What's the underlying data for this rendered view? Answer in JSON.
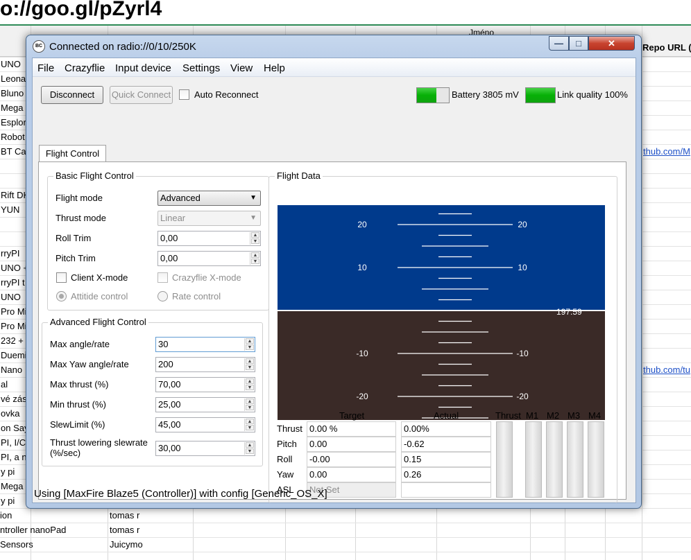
{
  "background": {
    "url_text": "o://goo.gl/pZyrl4",
    "header_name": "Jméno",
    "header_repo": "Repo URL (v",
    "left_rows": [
      "UNO",
      "Leonar",
      "Bluno",
      "Mega",
      "Esplor",
      "Robot",
      "BT Ca",
      "",
      "",
      "Rift DK",
      "YUN",
      "",
      "",
      "rryPI",
      "UNO +",
      "rryPI t",
      "UNO",
      "Pro Mi",
      "Pro Mi",
      "232 +",
      "Duemil",
      "Nano",
      "al",
      "vé zás",
      "ovka",
      "on Say",
      "PI, I/C",
      "PI, a n",
      "y pi",
      "Mega",
      "y pi"
    ],
    "bottom_rows": [
      {
        "left": "ion",
        "right": "tomas r"
      },
      {
        "left": "ntroller nanoPad",
        "right": "tomas r"
      },
      {
        "left": "Sensors",
        "right": "Juicymo"
      }
    ],
    "links": [
      "thub.com/M",
      "thub.com/tu"
    ]
  },
  "window": {
    "title": "Connected on radio://0/10/250K",
    "icon_text": "BC",
    "caption_min": "—",
    "caption_max": "□",
    "caption_close": "✕"
  },
  "menu": [
    "File",
    "Crazyflie",
    "Input device",
    "Settings",
    "View",
    "Help"
  ],
  "toolbar": {
    "disconnect": "Disconnect",
    "quick_connect": "Quick Connect",
    "auto_reconnect": "Auto Reconnect",
    "battery_label": "Battery 3805 mV",
    "battery_level": 0.6,
    "link_label": "Link quality 100%",
    "link_level": 1.0
  },
  "tab": "Flight Control",
  "basic": {
    "title": "Basic Flight Control",
    "flight_mode_label": "Flight mode",
    "flight_mode_value": "Advanced",
    "thrust_mode_label": "Thrust mode",
    "thrust_mode_value": "Linear",
    "roll_trim_label": "Roll Trim",
    "roll_trim_value": "0,00",
    "pitch_trim_label": "Pitch Trim",
    "pitch_trim_value": "0,00",
    "client_xmode": "Client X-mode",
    "crazyflie_xmode": "Crazyflie X-mode",
    "attitude": "Attitide control",
    "rate": "Rate control"
  },
  "advanced": {
    "title": "Advanced Flight Control",
    "max_angle_label": "Max angle/rate",
    "max_angle_value": "30",
    "max_yaw_label": "Max Yaw angle/rate",
    "max_yaw_value": "200",
    "max_thrust_label": "Max thrust (%)",
    "max_thrust_value": "70,00",
    "min_thrust_label": "Min thrust (%)",
    "min_thrust_value": "25,00",
    "slew_label": "SlewLimit (%)",
    "slew_value": "45,00",
    "slewrate_label_1": "Thrust lowering slewrate",
    "slewrate_label_2": "(%/sec)",
    "slewrate_value": "30,00"
  },
  "flight_data": {
    "title": "Flight Data",
    "horizon": {
      "sky_color": "#003a8c",
      "ground_color": "#3a2a27",
      "pitch_labels": [
        "20",
        "10",
        "-10",
        "-20"
      ],
      "pitch_label_values": [
        20,
        10,
        -10,
        -20
      ],
      "altitude_readout": "197.59"
    },
    "col_target": "Target",
    "col_actual": "Actual",
    "rows": [
      {
        "label": "Thrust",
        "target": "0.00 %",
        "actual": "0.00%"
      },
      {
        "label": "Pitch",
        "target": "0.00",
        "actual": "-0.62"
      },
      {
        "label": "Roll",
        "target": "-0.00",
        "actual": "0.15"
      },
      {
        "label": "Yaw",
        "target": "0.00",
        "actual": "0.26"
      },
      {
        "label": "ASL",
        "target": "Not Set",
        "actual": ""
      }
    ],
    "bars": [
      {
        "label": "Thrust",
        "level": 0
      },
      {
        "label": "M1",
        "level": 0
      },
      {
        "label": "M2",
        "level": 0
      },
      {
        "label": "M3",
        "level": 0
      },
      {
        "label": "M4",
        "level": 0
      }
    ]
  },
  "statusbar": "Using [MaxFire Blaze5 (Controller)] with config [Generic_OS_X]"
}
